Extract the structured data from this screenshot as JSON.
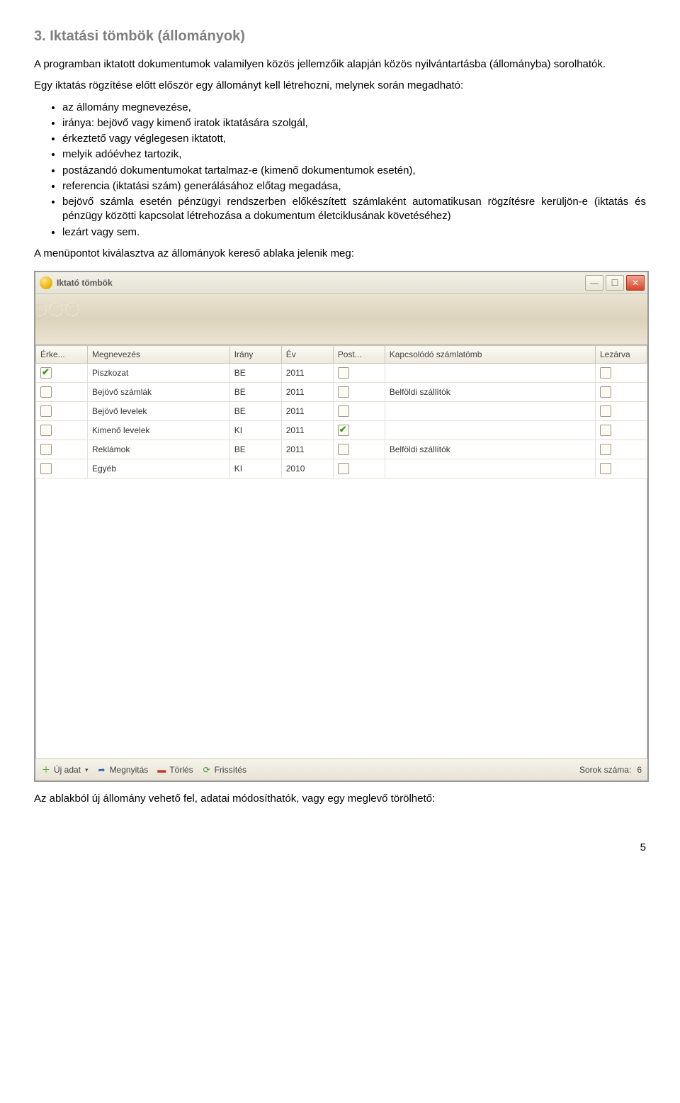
{
  "heading": "3. Iktatási tömbök (állományok)",
  "para1": "A programban iktatott dokumentumok valamilyen közös jellemzőik alapján közös nyilvántartásba (állományba) sorolhatók.",
  "para2_lead": "Egy iktatás rögzítése előtt először egy állományt kell létrehozni, melynek során megadható:",
  "bullets": [
    "az állomány megnevezése,",
    "iránya: bejövő vagy kimenő iratok iktatására szolgál,",
    "érkeztető vagy véglegesen iktatott,",
    "melyik adóévhez tartozik,",
    "postázandó dokumentumokat tartalmaz-e (kimenő dokumentumok esetén),",
    "referencia (iktatási szám) generálásához előtag megadása,"
  ],
  "bullet_long_pre": "bejövő számla esetén pénzügyi rendszerben előkészített számlaként automatikusan rögzítésre kerüljön-e (iktatás és pénzügy közötti kapcsolat létrehozása a dokumentum életciklusának követéséhez)",
  "bullet_last": "lezárt vagy sem.",
  "para3": "A menüpontot kiválasztva az állományok kereső ablaka jelenik meg:",
  "window": {
    "title": "Iktató tömbök",
    "columns": {
      "erke": "Érke...",
      "megnevezes": "Megnevezés",
      "irany": "Irány",
      "ev": "Év",
      "post": "Post...",
      "kapcsolodo": "Kapcsolódó számlatömb",
      "lezarva": "Lezárva"
    },
    "rows": [
      {
        "erke": true,
        "megnevezes": "Piszkozat",
        "irany": "BE",
        "ev": "2011",
        "post": false,
        "kapcs": "",
        "lez": false
      },
      {
        "erke": false,
        "megnevezes": "Bejövő számlák",
        "irany": "BE",
        "ev": "2011",
        "post": false,
        "kapcs": "Belföldi szállítók",
        "lez": false
      },
      {
        "erke": false,
        "megnevezes": "Bejövő levelek",
        "irany": "BE",
        "ev": "2011",
        "post": false,
        "kapcs": "",
        "lez": false
      },
      {
        "erke": false,
        "megnevezes": "Kimenő levelek",
        "irany": "KI",
        "ev": "2011",
        "post": true,
        "kapcs": "",
        "lez": false
      },
      {
        "erke": false,
        "megnevezes": "Reklámok",
        "irany": "BE",
        "ev": "2011",
        "post": false,
        "kapcs": "Belföldi szállítók",
        "lez": false
      },
      {
        "erke": false,
        "megnevezes": "Egyéb",
        "irany": "KI",
        "ev": "2010",
        "post": false,
        "kapcs": "",
        "lez": false
      }
    ],
    "statusbar": {
      "uj_adat": "Új adat",
      "megnyitas": "Megnyitás",
      "torles": "Törlés",
      "frissites": "Frissítés",
      "sorok_label": "Sorok száma:",
      "sorok": "6"
    }
  },
  "para4": "Az ablakból új állomány vehető fel, adatai módosíthatók, vagy egy meglevő törölhető:",
  "page_number": "5"
}
